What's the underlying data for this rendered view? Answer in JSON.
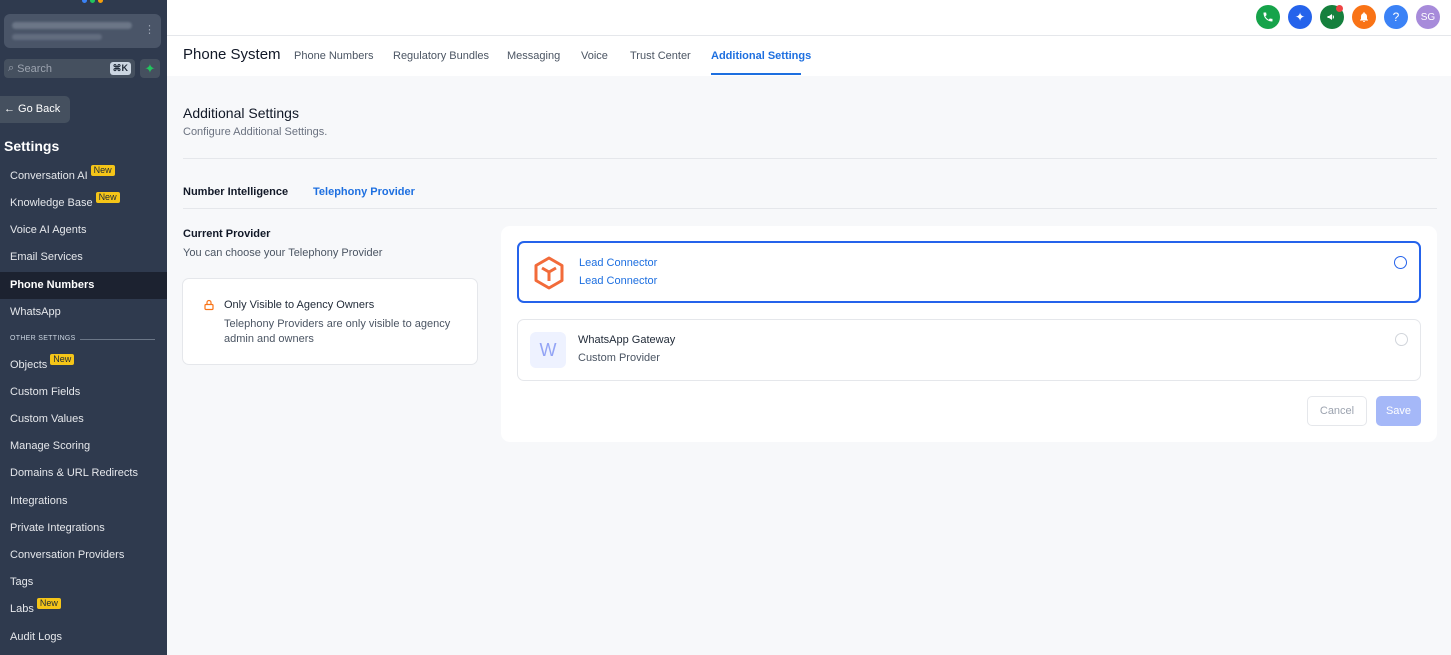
{
  "sidebar": {
    "search_placeholder": "Search",
    "search_shortcut": "⌘K",
    "go_back": "← Go Back",
    "title": "Settings",
    "other_settings_label": "OTHER SETTINGS",
    "new_badge": "New",
    "items": [
      {
        "label": "Conversation AI",
        "badge": "New"
      },
      {
        "label": "Knowledge Base",
        "badge": "New"
      },
      {
        "label": "Voice AI Agents"
      },
      {
        "label": "Email Services"
      },
      {
        "label": "Phone Numbers",
        "active": true
      },
      {
        "label": "WhatsApp"
      },
      {
        "label": "Objects",
        "badge": "New"
      },
      {
        "label": "Custom Fields"
      },
      {
        "label": "Custom Values"
      },
      {
        "label": "Manage Scoring"
      },
      {
        "label": "Domains & URL Redirects"
      },
      {
        "label": "Integrations"
      },
      {
        "label": "Private Integrations"
      },
      {
        "label": "Conversation Providers"
      },
      {
        "label": "Tags"
      },
      {
        "label": "Labs",
        "badge": "New"
      },
      {
        "label": "Audit Logs"
      }
    ]
  },
  "topbar": {
    "icons": [
      "phone-icon",
      "sparkle-icon",
      "megaphone-icon",
      "bell-icon",
      "help-icon"
    ],
    "avatar_initials": "SG",
    "help": "?"
  },
  "header": {
    "title": "Phone System",
    "tabs": [
      "Phone Numbers",
      "Regulatory Bundles",
      "Messaging",
      "Voice",
      "Trust Center",
      "Additional Settings"
    ],
    "active_tab": "Additional Settings"
  },
  "main": {
    "title": "Additional Settings",
    "subtitle": "Configure Additional Settings.",
    "subtabs": [
      "Number Intelligence",
      "Telephony Provider"
    ],
    "current_provider": {
      "title": "Current Provider",
      "subtitle": "You can choose your Telephony Provider"
    },
    "info": {
      "title": "Only Visible to Agency Owners",
      "text": "Telephony Providers are only visible to agency admin and owners"
    },
    "providers": [
      {
        "name": "Lead Connector",
        "type": "Lead Connector",
        "selected": true
      },
      {
        "name": "WhatsApp Gateway",
        "type": "Custom Provider",
        "logo_letter": "W",
        "selected": false
      }
    ],
    "cancel": "Cancel",
    "save": "Save"
  },
  "colors": {
    "sidebar_bg": "#2f3a4e",
    "accent": "#1d6fe0",
    "badge": "#f5c518"
  }
}
